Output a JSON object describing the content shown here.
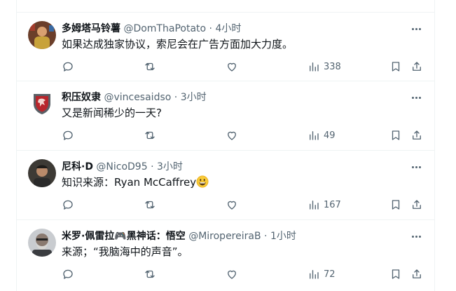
{
  "colors": {
    "text": "#0f1419",
    "secondary": "#536471",
    "border": "#eff3f4"
  },
  "separator": "·",
  "tweets": [
    {
      "display_name": "多姆塔马铃薯",
      "handle": "@DomThaPotato",
      "time": "4小时",
      "text": "如果达成独家协议，索尼会在广告方面加大力度。",
      "views": "338",
      "avatar": "avatar-photo"
    },
    {
      "display_name": "积压奴隶",
      "handle": "@vincesaidso",
      "time": "3小时",
      "text": "又是新闻稀少的一天?",
      "views": "49",
      "avatar": "avatar-shield-crest"
    },
    {
      "display_name": "尼科·D",
      "handle": "@NicoD95",
      "time": "3小时",
      "text": "知识来源：Ryan McCaffrey",
      "emoji": "grinning-face-emoji",
      "views": "167",
      "avatar": "avatar-photo"
    },
    {
      "display_name": "米罗·佩雷拉🎮黑神话：悟空",
      "handle": "@MiropereiraB",
      "time": "1小时",
      "text": "来源；“我脑海中的声音”。",
      "views": "72",
      "avatar": "avatar-photo"
    }
  ]
}
